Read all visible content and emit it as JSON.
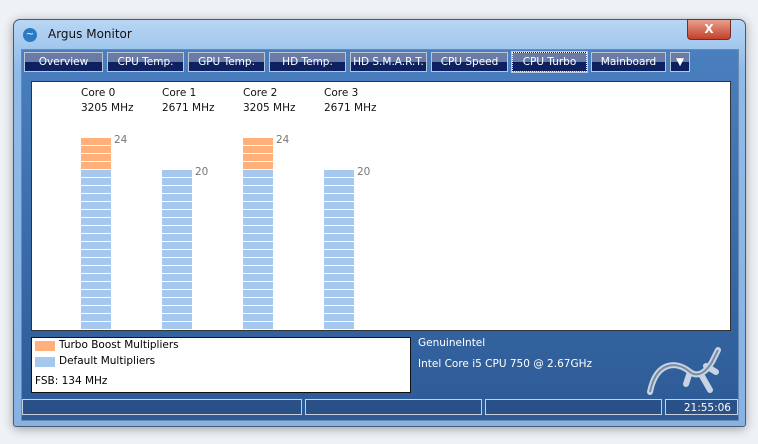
{
  "window": {
    "title": "Argus Monitor",
    "close_label": "X"
  },
  "tabs": [
    {
      "label": "Overview",
      "w": 77
    },
    {
      "label": "CPU Temp.",
      "w": 75
    },
    {
      "label": "GPU Temp.",
      "w": 75
    },
    {
      "label": "HD Temp.",
      "w": 75
    },
    {
      "label": "HD S.M.A.R.T.",
      "w": 75
    },
    {
      "label": "CPU Speed",
      "w": 75
    },
    {
      "label": "CPU Turbo",
      "w": 73,
      "active": true
    },
    {
      "label": "Mainboard",
      "w": 73
    }
  ],
  "tab_overflow_label": "▼",
  "cores": [
    {
      "name": "Core 0",
      "freq": "3205 MHz",
      "multiplier": 24,
      "default": 20
    },
    {
      "name": "Core 1",
      "freq": "2671 MHz",
      "multiplier": 20,
      "default": 20
    },
    {
      "name": "Core 2",
      "freq": "3205 MHz",
      "multiplier": 24,
      "default": 20
    },
    {
      "name": "Core 3",
      "freq": "2671 MHz",
      "multiplier": 20,
      "default": 20
    }
  ],
  "colors": {
    "turbo": "#ffb07a",
    "default": "#a6c8ee"
  },
  "legend": {
    "turbo": "Turbo Boost Multipliers",
    "default": "Default Multipliers",
    "fsb": "FSB: 134 MHz"
  },
  "cpu": {
    "vendor": "GenuineIntel",
    "model": "Intel Core i5 CPU 750 @ 2.67GHz"
  },
  "status": {
    "time": "21:55:06"
  }
}
